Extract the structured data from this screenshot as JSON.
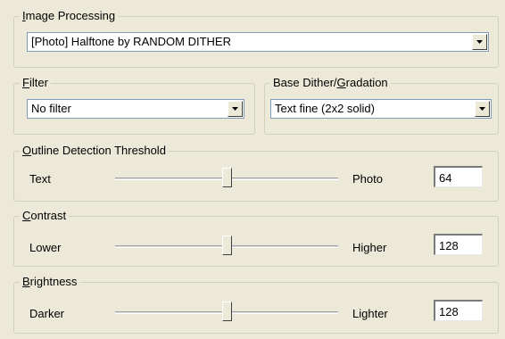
{
  "image_processing": {
    "legend_pre": "",
    "legend_key": "I",
    "legend_post": "mage Processing",
    "selected": "[Photo] Halftone by RANDOM DITHER"
  },
  "filter": {
    "legend_key": "F",
    "legend_post": "ilter",
    "selected": "No filter"
  },
  "base_dither": {
    "legend_pre": "Base Dither/",
    "legend_key": "G",
    "legend_post": "radation",
    "selected": "Text fine (2x2 solid)"
  },
  "outline": {
    "legend_key": "O",
    "legend_post": "utline Detection Threshold",
    "left_label": "Text",
    "right_label": "Photo",
    "value": "64",
    "slider_fraction": 0.5
  },
  "contrast": {
    "legend_key": "C",
    "legend_post": "ontrast",
    "left_label": "Lower",
    "right_label": "Higher",
    "value": "128",
    "slider_fraction": 0.5
  },
  "brightness": {
    "legend_key": "B",
    "legend_post": "rightness",
    "left_label": "Darker",
    "right_label": "Lighter",
    "value": "128",
    "slider_fraction": 0.5
  },
  "icons": {
    "dropdown": "chevron-down-icon"
  }
}
